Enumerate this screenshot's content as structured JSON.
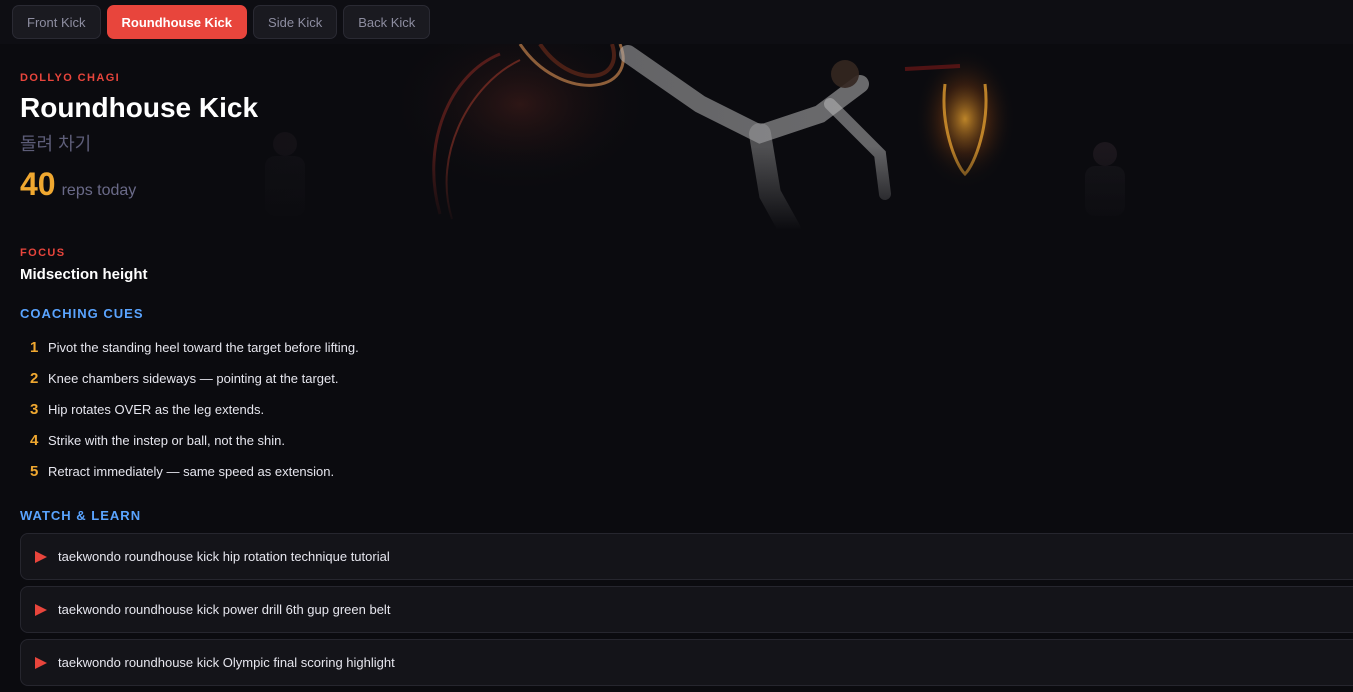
{
  "tabs": [
    {
      "label": "Front Kick",
      "active": false
    },
    {
      "label": "Roundhouse Kick",
      "active": true
    },
    {
      "label": "Side Kick",
      "active": false
    },
    {
      "label": "Back Kick",
      "active": false
    }
  ],
  "technique": {
    "romanized": "DOLLYO CHAGI",
    "name": "Roundhouse Kick",
    "korean": "돌려 차기",
    "reps_count": "40",
    "reps_label": "reps today"
  },
  "focus": {
    "label": "FOCUS",
    "value": "Midsection height"
  },
  "coaching": {
    "label": "COACHING CUES",
    "cues": [
      {
        "num": "1",
        "text": "Pivot the standing heel toward the target before lifting."
      },
      {
        "num": "2",
        "text": "Knee chambers sideways — pointing at the target."
      },
      {
        "num": "3",
        "text": "Hip rotates OVER as the leg extends."
      },
      {
        "num": "4",
        "text": "Strike with the instep or ball, not the shin."
      },
      {
        "num": "5",
        "text": "Retract immediately — same speed as extension."
      }
    ]
  },
  "watch": {
    "label": "WATCH & LEARN",
    "videos": [
      {
        "title": "taekwondo roundhouse kick hip rotation technique tutorial"
      },
      {
        "title": "taekwondo roundhouse kick power drill 6th gup green belt"
      },
      {
        "title": "taekwondo roundhouse kick Olympic final scoring highlight"
      }
    ]
  },
  "colors": {
    "accent": "#e8453c",
    "highlight": "#f0a830",
    "section": "#5aa4ff",
    "background": "#0b0b0f"
  }
}
